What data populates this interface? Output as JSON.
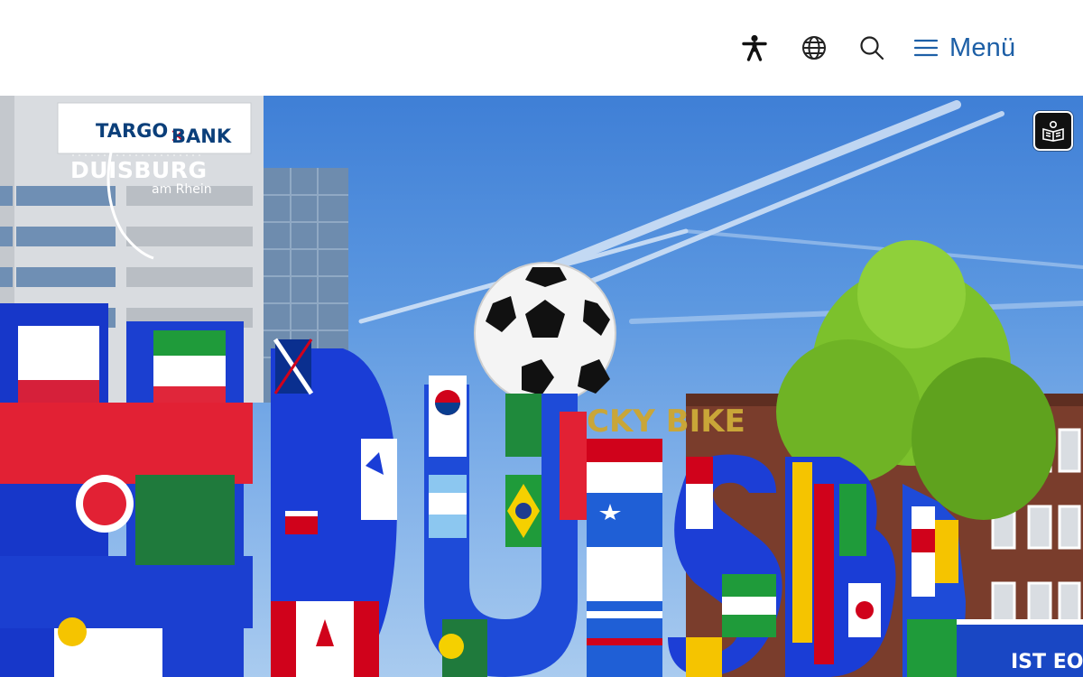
{
  "header": {
    "accessibility_icon": "accessibility-person-icon",
    "language_icon": "globe-icon",
    "search_icon": "search-icon",
    "menu_icon": "hamburger-icon",
    "menu_label": "Menü",
    "accent_color": "#1d5fa6"
  },
  "hero": {
    "logo": {
      "wordmark": "DUISBURG",
      "subline": "am Rhein"
    },
    "building_sign": {
      "left": "TARGO",
      "right": "BANK"
    },
    "background_sign": "CKY BIKE",
    "reader_button_icon": "easy-language-book-icon"
  }
}
